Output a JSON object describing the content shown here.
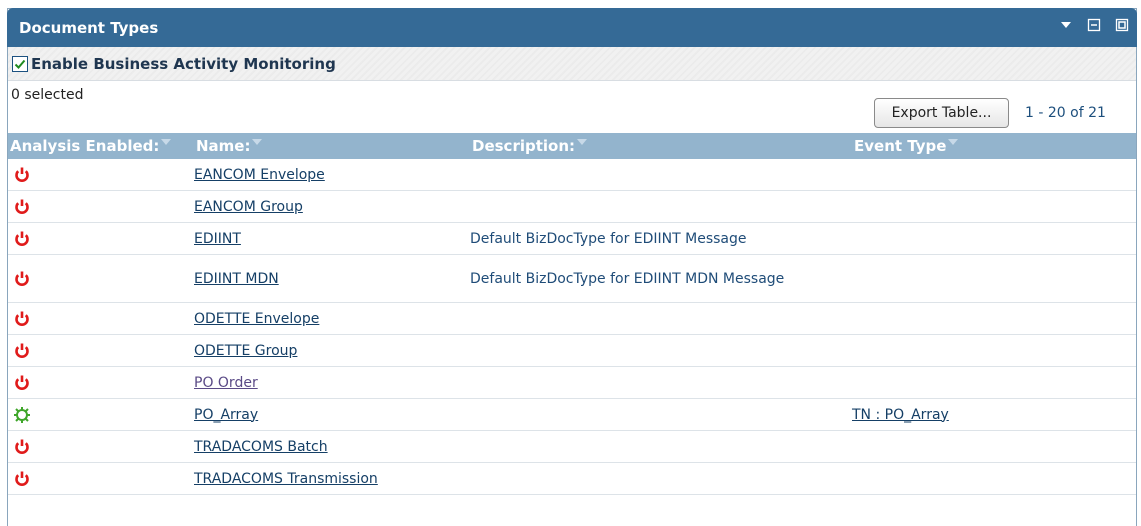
{
  "panel": {
    "title": "Document Types",
    "icons": [
      "collapse-arrow-icon",
      "minimize-icon",
      "maximize-icon"
    ]
  },
  "bam": {
    "label": "Enable Business Activity Monitoring",
    "checked": true
  },
  "toolbar": {
    "selected_count": "0 selected",
    "export_label": "Export Table...",
    "range": "1 - 20 of 21"
  },
  "table": {
    "headers": [
      "Analysis Enabled:",
      "Name:",
      "Description:",
      "Event Type"
    ],
    "rows": [
      {
        "enabled": false,
        "name": "EANCOM Envelope",
        "description": "",
        "event_type": ""
      },
      {
        "enabled": false,
        "name": "EANCOM Group",
        "description": "",
        "event_type": ""
      },
      {
        "enabled": false,
        "name": "EDIINT",
        "description": "Default BizDocType for EDIINT Message",
        "event_type": ""
      },
      {
        "enabled": false,
        "name": "EDIINT MDN",
        "description": "Default BizDocType for EDIINT MDN Message",
        "event_type": ""
      },
      {
        "enabled": false,
        "name": "ODETTE Envelope",
        "description": "",
        "event_type": ""
      },
      {
        "enabled": false,
        "name": "ODETTE Group",
        "description": "",
        "event_type": ""
      },
      {
        "enabled": false,
        "name": "PO Order",
        "description": "",
        "event_type": ""
      },
      {
        "enabled": true,
        "name": "PO_Array",
        "description": "",
        "event_type": "TN : PO_Array"
      },
      {
        "enabled": false,
        "name": "TRADACOMS Batch",
        "description": "",
        "event_type": ""
      },
      {
        "enabled": false,
        "name": "TRADACOMS Transmission",
        "description": "",
        "event_type": ""
      }
    ]
  },
  "colors": {
    "titlebar": "#356a96",
    "header": "#93b4cd",
    "disabled_icon": "#e01b1b",
    "enabled_icon": "#3fa62a"
  }
}
